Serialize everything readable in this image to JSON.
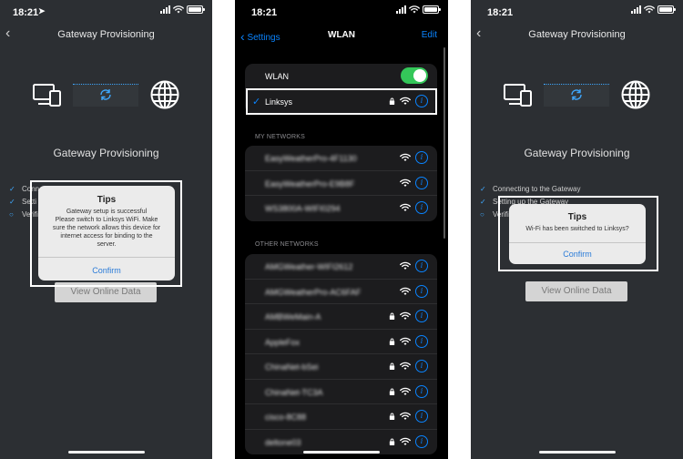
{
  "screen1": {
    "time": "18:21",
    "nav_title": "Gateway Provisioning",
    "heading": "Gateway Provisioning",
    "steps": [
      "Conn",
      "Setti",
      "Verifi"
    ],
    "view_button": "View Online Data",
    "dialog": {
      "title": "Tips",
      "message_lines": [
        "Gateway setup is successful",
        "Please switch to Linksys WiFi. Make",
        "sure the network allows this device for",
        "internet access for binding to the",
        "server."
      ],
      "confirm": "Confirm"
    }
  },
  "screen2": {
    "time": "18:21",
    "back_label": "Settings",
    "title": "WLAN",
    "edit_label": "Edit",
    "wlan_label": "WLAN",
    "wlan_on": true,
    "connected_network": "Linksys",
    "my_networks_header": "MY NETWORKS",
    "my_networks": [
      "EasyWeatherPro-4F1130",
      "EasyWeatherPro-E9B8F",
      "WS3800A-WIFI0294"
    ],
    "other_networks_header": "OTHER NETWORKS",
    "other_networks": [
      {
        "name": "AMGWeather-WIFI2612",
        "locked": false
      },
      {
        "name": "AMGWeatherPro-AC6FAF",
        "locked": false
      },
      {
        "name": "AMBWeMain-A",
        "locked": true
      },
      {
        "name": "AppleFox",
        "locked": true
      },
      {
        "name": "ChinaNet-bSei",
        "locked": true
      },
      {
        "name": "ChinaNet-TC3A",
        "locked": true
      },
      {
        "name": "cisco-8C88",
        "locked": true
      },
      {
        "name": "deltone03",
        "locked": true
      }
    ],
    "info_glyph": "i"
  },
  "screen3": {
    "time": "18:21",
    "nav_title": "Gateway Provisioning",
    "heading": "Gateway Provisioning",
    "steps": [
      "Connecting to the Gateway",
      "Setting up the Gateway",
      "Verifi"
    ],
    "view_button": "View Online Data",
    "dialog": {
      "title": "Tips",
      "message": "Wi-Fi has been switched to Linksys?",
      "confirm": "Confirm"
    }
  },
  "colors": {
    "accent_blue": "#3fa9ff",
    "ios_blue": "#0a84ff",
    "toggle_green": "#34c759",
    "app_background": "#2c2f33"
  },
  "icons": [
    "location-arrow-icon",
    "signal-icon",
    "wifi-icon",
    "battery-icon",
    "back-chevron-icon",
    "devices-icon",
    "sync-icon",
    "globe-icon",
    "check-icon",
    "lock-icon",
    "info-icon"
  ]
}
